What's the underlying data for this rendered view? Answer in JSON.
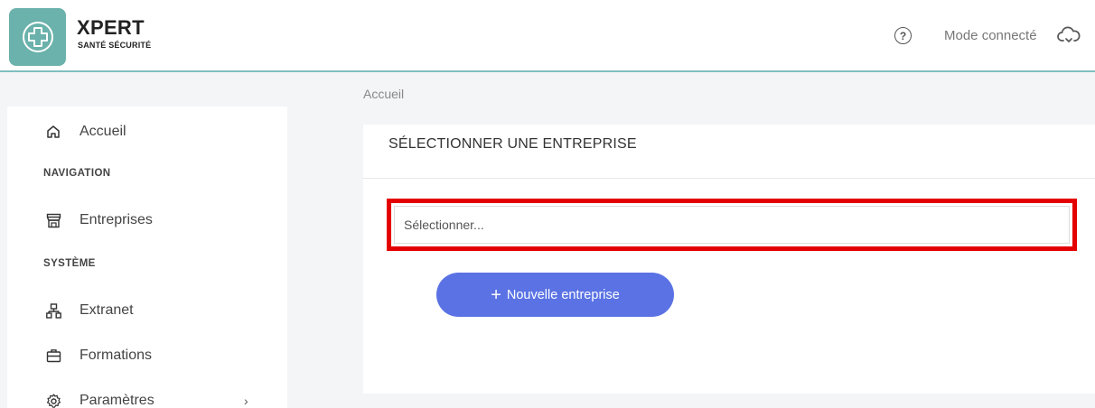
{
  "header": {
    "brand_name": "XPERT",
    "brand_sub": "SANTÉ SÉCURITÉ",
    "help_icon": "?",
    "mode_label": "Mode connecté",
    "accent_color": "#6ab2ab"
  },
  "sidebar": {
    "home_label": "Accueil",
    "navigation_section": "NAVIGATION",
    "companies_label": "Entreprises",
    "system_section": "SYSTÈME",
    "extranet_label": "Extranet",
    "trainings_label": "Formations",
    "settings_label": "Paramètres",
    "settings_chevron": "›"
  },
  "breadcrumb": "Accueil",
  "card": {
    "title": "SÉLECTIONNER UNE ENTREPRISE",
    "select_placeholder": "Sélectionner...",
    "new_button_plus": "+",
    "new_button_label": "Nouvelle entreprise",
    "button_color": "#5a72e4",
    "highlight_color": "#e40000"
  }
}
